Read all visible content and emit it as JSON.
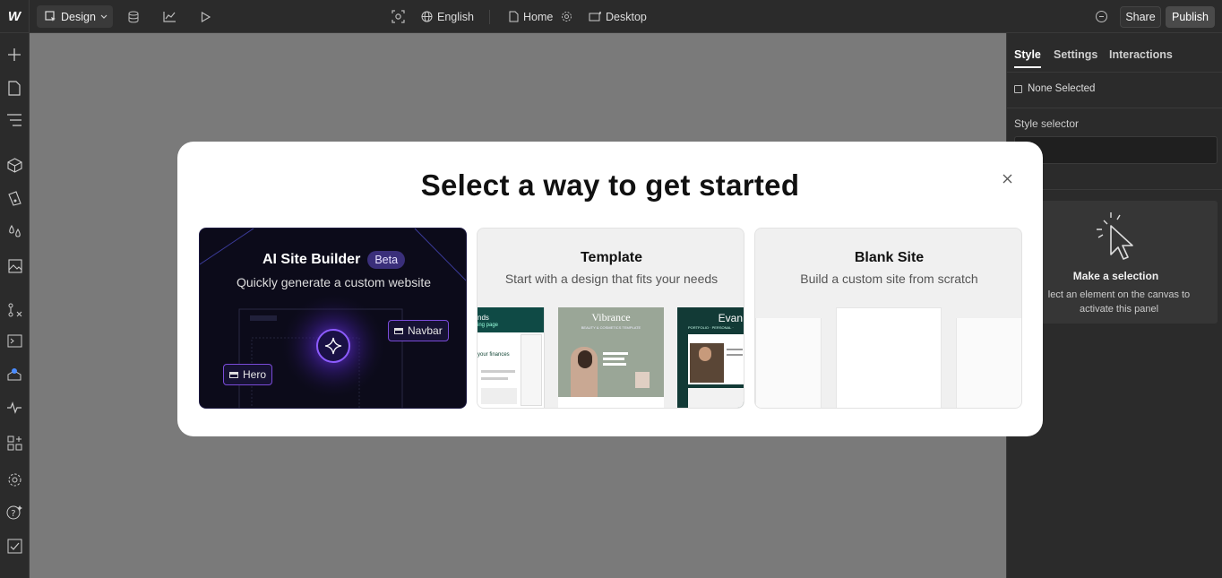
{
  "toolbar": {
    "logo": "W",
    "mode_label": "Design",
    "language_label": "English",
    "page_label": "Home",
    "breakpoint_label": "Desktop",
    "share_label": "Share",
    "publish_label": "Publish"
  },
  "right_panel": {
    "tabs": [
      {
        "label": "Style",
        "active": true
      },
      {
        "label": "Settings",
        "active": false
      },
      {
        "label": "Interactions",
        "active": false
      }
    ],
    "selection_label": "None Selected",
    "style_selector_label": "Style selector",
    "style_selector_placeholder": "e",
    "empty_state_title": "Make a selection",
    "empty_state_description": "lect an element on the canvas to activate this panel"
  },
  "modal": {
    "title": "Select a way to get started",
    "options": [
      {
        "title": "AI Site Builder",
        "badge": "Beta",
        "subtitle": "Quickly generate a custom website",
        "chips": [
          "Navbar",
          "Hero"
        ]
      },
      {
        "title": "Template",
        "subtitle": "Start with a design that fits your needs",
        "previews": [
          {
            "heading": "nds",
            "sub": "ing page",
            "line": "your finances"
          },
          {
            "heading": "Vibrance",
            "sub": "BEAUTY & COSMETICS TEMPLATE"
          },
          {
            "heading": "Evan",
            "sub": "PORTFOLIO · PERSONAL ·"
          }
        ]
      },
      {
        "title": "Blank Site",
        "subtitle": "Build a custom site from scratch"
      }
    ]
  },
  "colors": {
    "canvas": "#7a7a7a",
    "panel": "#2b2b2b",
    "accent_purple": "#7a4bd8",
    "modal_bg": "#ffffff"
  }
}
